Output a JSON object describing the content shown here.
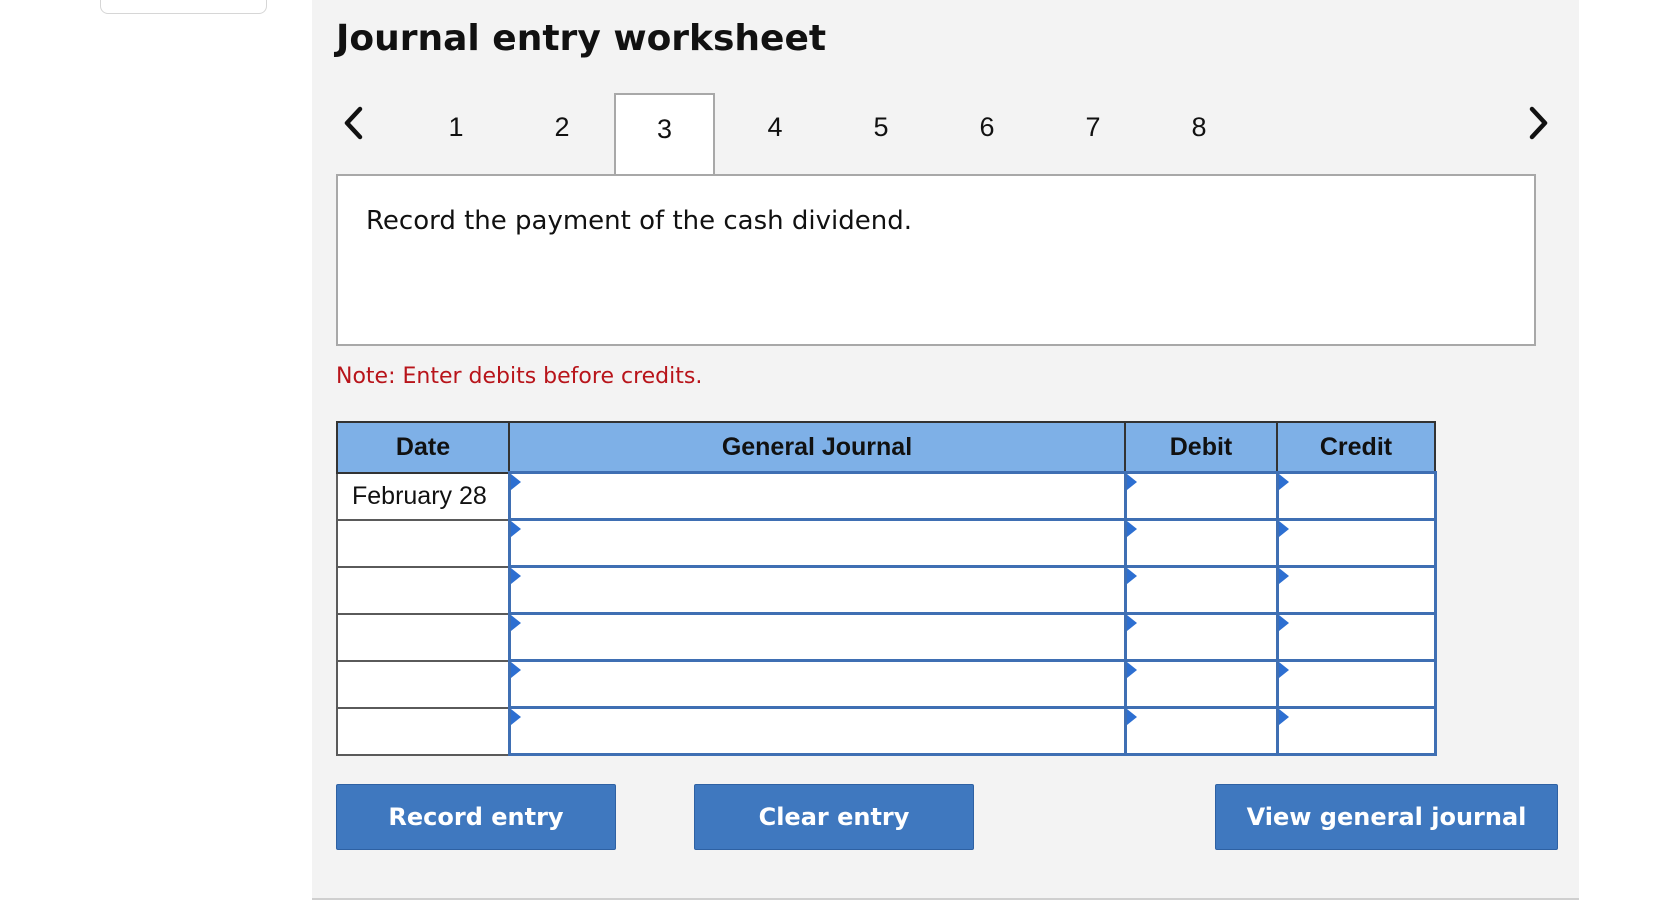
{
  "worksheet": {
    "title": "Journal entry worksheet",
    "tabs": [
      "1",
      "2",
      "3",
      "4",
      "5",
      "6",
      "7",
      "8"
    ],
    "active_tab": "3"
  },
  "prompt": "Record the payment of the cash dividend.",
  "note": "Note: Enter debits before credits.",
  "journal": {
    "headers": {
      "date": "Date",
      "general_journal": "General Journal",
      "debit": "Debit",
      "credit": "Credit"
    },
    "rows": [
      {
        "date": "February 28",
        "account": "",
        "debit": "",
        "credit": ""
      },
      {
        "date": "",
        "account": "",
        "debit": "",
        "credit": ""
      },
      {
        "date": "",
        "account": "",
        "debit": "",
        "credit": ""
      },
      {
        "date": "",
        "account": "",
        "debit": "",
        "credit": ""
      },
      {
        "date": "",
        "account": "",
        "debit": "",
        "credit": ""
      },
      {
        "date": "",
        "account": "",
        "debit": "",
        "credit": ""
      }
    ]
  },
  "buttons": {
    "record": "Record entry",
    "clear": "Clear entry",
    "view": "View general journal"
  },
  "icons": {
    "prev": "chevron-left-icon",
    "next": "chevron-right-icon"
  },
  "colors": {
    "header_bg": "#7eb0e7",
    "button_bg": "#3f78bf",
    "note_text": "#b8141a"
  }
}
